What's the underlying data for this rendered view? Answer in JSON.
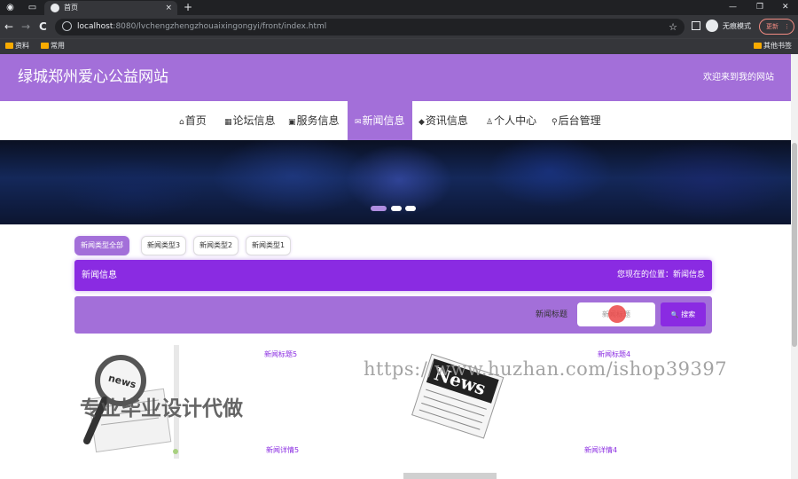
{
  "browser": {
    "tab_title": "首页",
    "tab_close": "×",
    "new_tab": "+",
    "url_host": "localhost",
    "url_path": ":8080/lvchengzhengzhouaixingongyi/front/index.html",
    "incognito_label": "无痕模式",
    "update_label": "更新",
    "bookmarks": [
      "资料",
      "常用"
    ],
    "other_bookmarks": "其他书签",
    "icons": {
      "back": "←",
      "forward": "→",
      "reload": "C",
      "star": "☆",
      "minimize": "—",
      "restore": "❐",
      "close": "✕",
      "menu": "⋮"
    }
  },
  "site": {
    "title": "绿城郑州爱心公益网站",
    "welcome": "欢迎来到我的网站",
    "nav": [
      {
        "icon": "⌂",
        "label": "首页"
      },
      {
        "icon": "▦",
        "label": "论坛信息"
      },
      {
        "icon": "▣",
        "label": "服务信息"
      },
      {
        "icon": "✉",
        "label": "新闻信息"
      },
      {
        "icon": "◆",
        "label": "资讯信息"
      },
      {
        "icon": "♙",
        "label": "个人中心"
      },
      {
        "icon": "⚲",
        "label": "后台管理"
      }
    ],
    "active_nav": "新闻信息",
    "carousel_dots": 3,
    "carousel_active": 0
  },
  "filters": [
    "新闻类型全部",
    "新闻类型3",
    "新闻类型2",
    "新闻类型1"
  ],
  "section": {
    "title": "新闻信息",
    "breadcrumb": "您现在的位置：新闻信息"
  },
  "search": {
    "label": "新闻标题",
    "placeholder": "新闻标题",
    "button": "搜索",
    "button_icon": "🔍"
  },
  "news": [
    {
      "title": "新闻标题5",
      "detail": "新闻详情5",
      "image": "news-magnifier"
    },
    {
      "title": "新闻标题4",
      "detail": "新闻详情4",
      "image": "news-newspaper"
    }
  ],
  "watermarks": {
    "cn": "专业毕业设计代做",
    "url": "https://www.huzhan.com/ishop39397"
  },
  "colors": {
    "header": "#a36fd9",
    "accent": "#8a2be2",
    "link": "#8a2be2"
  }
}
